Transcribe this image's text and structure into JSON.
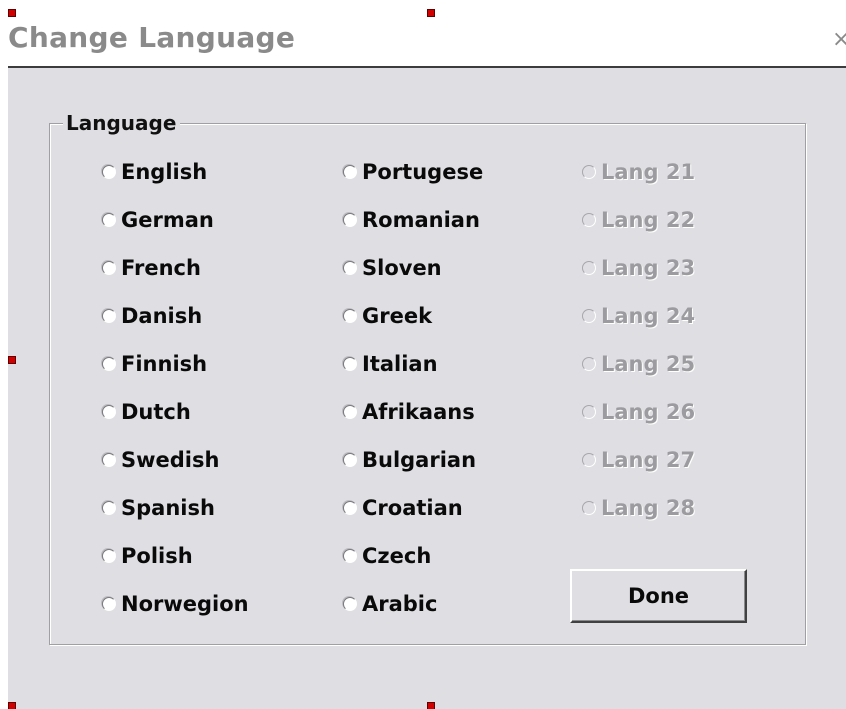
{
  "window": {
    "title": "Change Language",
    "close_glyph": "×"
  },
  "group": {
    "label": "Language"
  },
  "languages": {
    "col1": [
      "English",
      "German",
      "French",
      "Danish",
      "Finnish",
      "Dutch",
      "Swedish",
      "Spanish",
      "Polish",
      "Norwegion"
    ],
    "col2": [
      "Portugese",
      "Romanian",
      "Sloven",
      "Greek",
      "Italian",
      "Afrikaans",
      "Bulgarian",
      "Croatian",
      "Czech",
      "Arabic"
    ],
    "col3": [
      "Lang 21",
      "Lang 22",
      "Lang 23",
      "Lang 24",
      "Lang 25",
      "Lang 26",
      "Lang 27",
      "Lang 28"
    ]
  },
  "buttons": {
    "done": "Done"
  },
  "colors": {
    "dialog_bg": "#dfdfe3",
    "disabled_text": "#9c9ca0",
    "selection_handle": "#d00000"
  }
}
